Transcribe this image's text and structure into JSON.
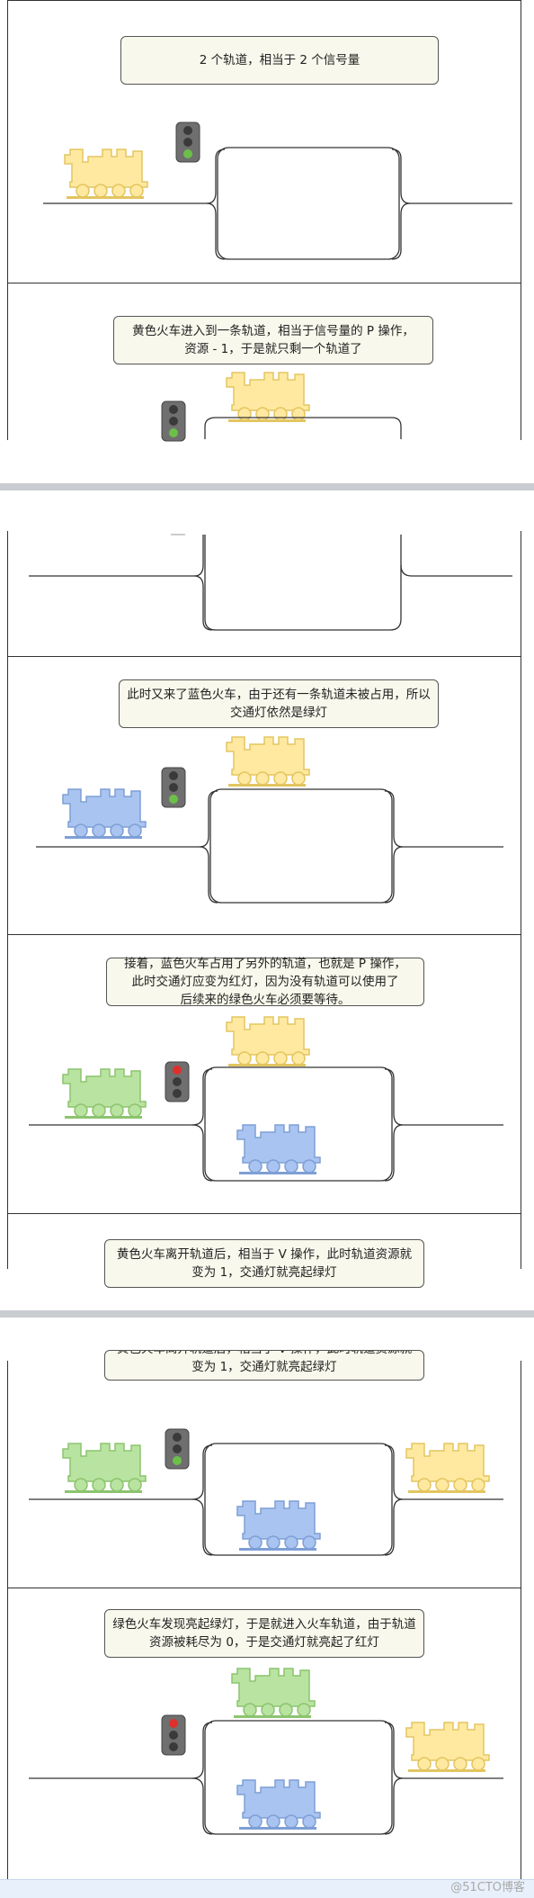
{
  "panels": [
    {
      "caption": "2 个轨道，相当于 2 个信号量"
    },
    {
      "caption": "黄色火车进入到一条轨道，相当于信号量的 P 操作，\n资源 - 1，于是就只剩一个轨道了"
    },
    {
      "caption": "此时又来了蓝色火车，由于还有一条轨道未被占用，所以\n交通灯依然是绿灯"
    },
    {
      "caption": "接着，蓝色火车占用了另外的轨道，也就是 P 操作，\n此时交通灯应变为红灯，因为没有轨道可以使用了\n后续来的绿色火车必须要等待。"
    },
    {
      "caption": "黄色火车离开轨道后，相当于 V 操作，此时轨道资源就\n变为 1，交通灯就亮起绿灯"
    },
    {
      "caption": "绿色火车发现亮起绿灯，于是就进入火车轨道，由于轨道\n资源被耗尽为 0，于是交通灯就亮起了红灯"
    }
  ],
  "colors": {
    "yellow_train": "#ffe9a0",
    "yellow_stroke": "#e3c560",
    "blue_train": "#a9c4f0",
    "blue_stroke": "#7e9fd6",
    "green_train": "#b9e3a0",
    "green_stroke": "#8cc46e",
    "light_green": "#6cc04a",
    "light_red": "#e0302c"
  },
  "watermark": "@51CTO博客"
}
